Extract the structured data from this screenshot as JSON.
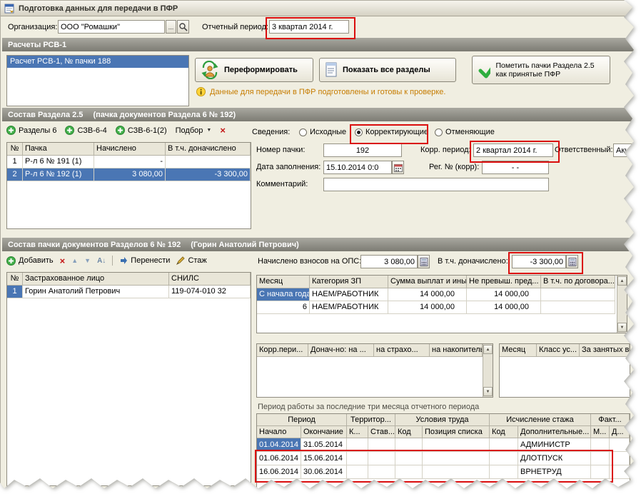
{
  "window": {
    "title": "Подготовка данных для передачи в ПФР"
  },
  "toprow": {
    "org_label": "Организация:",
    "org_value": "ООО \"Ромашки\"",
    "period_label": "Отчетный период:",
    "period_value": "3 квартал 2014 г."
  },
  "rsv": {
    "header": "Расчеты РСВ-1",
    "list_item": "Расчет РСВ-1, № пачки 188",
    "reform": "Переформировать",
    "show_all": "Показать все разделы",
    "mark": "Пометить пачки Раздела 2.5 как принятые ПФР",
    "info": "Данные для передачи в ПФР подготовлены и готовы к проверке."
  },
  "s25": {
    "header": "Состав Раздела 2.5",
    "header_sub": "(пачка документов Раздела 6 № 192)",
    "tb": {
      "sections6": "Разделы 6",
      "szv64": "СЗВ-6-4",
      "szv612": "СЗВ-6-1(2)",
      "podbor": "Подбор"
    },
    "sved": {
      "label": "Сведения:",
      "r1": "Исходные",
      "r2": "Корректирующие",
      "r3": "Отменяющие"
    },
    "tbl": {
      "h": [
        "№",
        "Пачка",
        "Начислено",
        "В т.ч. доначислено"
      ],
      "rows": [
        [
          "1",
          "Р-л 6 № 191 (1)",
          "-",
          ""
        ],
        [
          "2",
          "Р-л 6 № 192 (1)",
          "3 080,00",
          "-3 300,00"
        ]
      ]
    },
    "f": {
      "num_l": "Номер пачки:",
      "num_v": "192",
      "korr_l": "Корр. период:",
      "korr_v": "2 квартал 2014 г.",
      "resp_l": "Ответственный:",
      "resp_v": "Аки",
      "date_l": "Дата заполнения:",
      "date_v": "15.10.2014 0:0",
      "reg_l": "Рег. № (корр):",
      "reg_v": "- -",
      "comm_l": "Комментарий:",
      "comm_v": ""
    }
  },
  "s6": {
    "header": "Состав пачки документов Разделов 6 № 192",
    "header_sub": "(Горин Анатолий Петрович)",
    "tb": {
      "add": "Добавить",
      "move": "Перенести",
      "stazh": "Стаж"
    },
    "ops_l": "Начислено взносов на ОПС:",
    "ops_v": "3 080,00",
    "don_l": "В т.ч. доначислено:",
    "don_v": "-3 300,00",
    "persons": {
      "h": [
        "№",
        "Застрахованное лицо",
        "СНИЛС"
      ],
      "rows": [
        [
          "1",
          "Горин Анатолий Петрович",
          "119-074-010 32"
        ]
      ]
    },
    "pay": {
      "h": [
        "Месяц",
        "Категория ЗП",
        "Сумма выплат и иных...",
        "Не превыш. пред...",
        "В т.ч. по договора..."
      ],
      "rows": [
        [
          "С начала года",
          "НАЕМ/РАБОТНИК",
          "14 000,00",
          "14 000,00",
          ""
        ],
        [
          "6",
          "НАЕМ/РАБОТНИК",
          "14 000,00",
          "14 000,00",
          ""
        ]
      ]
    },
    "korr": {
      "h": [
        "Корр.пери...",
        "Донач-но: на ...",
        "на страхо...",
        "на накопитель..."
      ]
    },
    "cls": {
      "h": [
        "Месяц",
        "Класс ус...",
        "За занятых в..."
      ]
    },
    "period_label": "Период работы за последние три месяца отчетного периода",
    "pt": {
      "groups": [
        "Период",
        "Территор...",
        "Условия труда",
        "Исчисление стажа",
        "Факт..."
      ],
      "sub": [
        "Начало",
        "Окончание",
        "К...",
        "Став...",
        "Код",
        "Позиция списка",
        "Код",
        "Дополнительные...",
        "М...",
        "Д..."
      ],
      "rows": [
        [
          "01.04.2014",
          "31.05.2014",
          "",
          "",
          "",
          "",
          "",
          "АДМИНИСТР",
          "",
          ""
        ],
        [
          "01.06.2014",
          "15.06.2014",
          "",
          "",
          "",
          "",
          "",
          "ДЛОТПУСК",
          "",
          ""
        ],
        [
          "16.06.2014",
          "30.06.2014",
          "",
          "",
          "",
          "",
          "",
          "ВРНЕТРУД",
          "",
          ""
        ]
      ]
    }
  },
  "icons": {
    "dots": "...",
    "dropdown": "▼",
    "close_x": "×",
    "up": "▲",
    "down": "▼",
    "sort": "А↓",
    "scroll_up": "▲",
    "scroll_down": "▼",
    "move": "►"
  }
}
